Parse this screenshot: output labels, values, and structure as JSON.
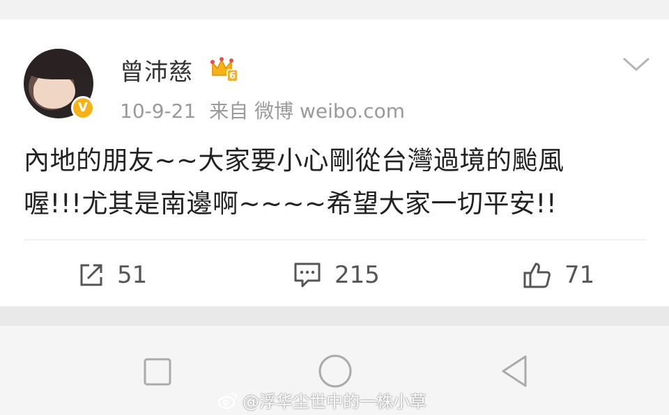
{
  "post": {
    "username": "曾沛慈",
    "level_badge": "6",
    "verified_mark": "V",
    "timestamp": "10-9-21",
    "source": "来自 微博 weibo.com",
    "text_line1": "內地的朋友~~大家要小心剛從台灣過境的颱風",
    "text_line2": "喔!!!尤其是南邊啊~~~~希望大家一切平安!!"
  },
  "actions": {
    "repost_count": "51",
    "comment_count": "215",
    "like_count": "71"
  },
  "icons": {
    "more": "chevron-down-icon",
    "repost": "repost-icon",
    "comment": "comment-icon",
    "like": "thumbs-up-icon",
    "nav_recent": "square-icon",
    "nav_home": "circle-icon",
    "nav_back": "triangle-back-icon"
  },
  "watermark": {
    "text": "@浮华尘世中的一株小草"
  },
  "colors": {
    "accent_gold": "#f6b21a",
    "meta_gray": "#9a9a9a",
    "text_dark": "#222222"
  }
}
